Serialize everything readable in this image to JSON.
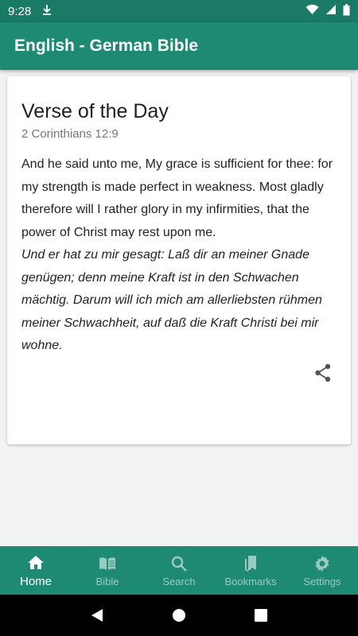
{
  "status_bar": {
    "time": "9:28",
    "icons": [
      "download-icon",
      "wifi-icon",
      "signal-icon",
      "battery-icon"
    ]
  },
  "app_bar": {
    "title": "English - German Bible"
  },
  "verse_card": {
    "title": "Verse of the Day",
    "reference": "2 Corinthians 12:9",
    "text_en": "And he said unto me, My grace is sufficient for thee: for my strength is made perfect in weakness. Most gladly therefore will I rather glory in my infirmities, that the power of Christ may rest upon me.",
    "text_de": "Und er hat zu mir gesagt: Laß dir an meiner Gnade genügen; denn meine Kraft ist in den Schwachen mächtig. Darum will ich mich am allerliebsten rühmen meiner Schwachheit, auf daß die Kraft Christi bei mir wohne.",
    "share_icon": "share-icon"
  },
  "bottom_nav": {
    "items": [
      {
        "label": "Home",
        "icon": "home-icon",
        "active": true
      },
      {
        "label": "Bible",
        "icon": "book-icon",
        "active": false
      },
      {
        "label": "Search",
        "icon": "search-icon",
        "active": false
      },
      {
        "label": "Bookmarks",
        "icon": "bookmarks-icon",
        "active": false
      },
      {
        "label": "Settings",
        "icon": "gear-icon",
        "active": false
      }
    ]
  },
  "colors": {
    "primary": "#1e8a73",
    "primary_dark": "#1a7a66"
  }
}
